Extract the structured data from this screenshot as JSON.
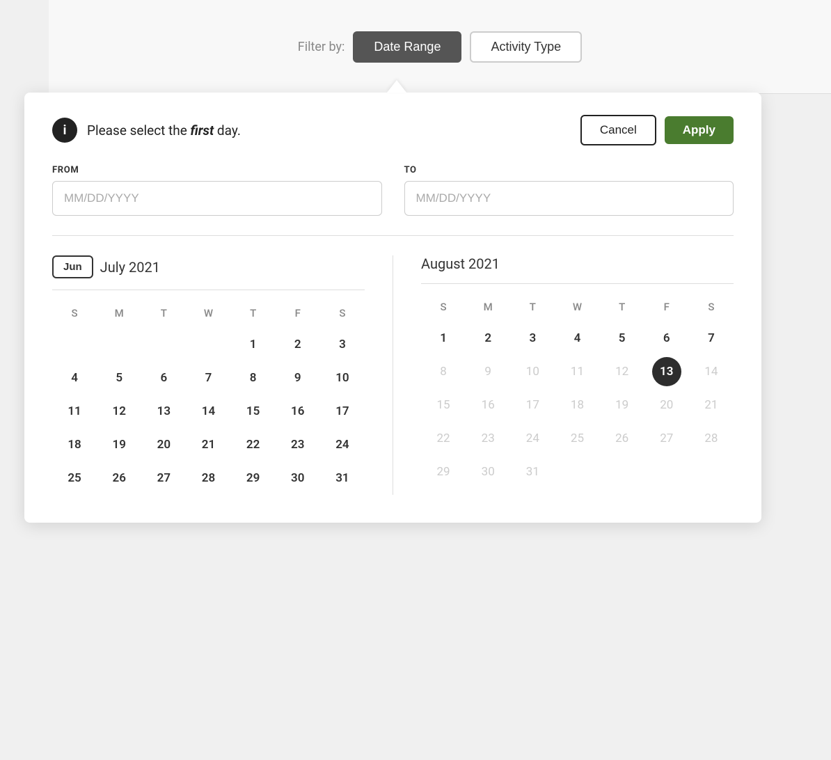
{
  "filterBar": {
    "label": "Filter by:",
    "btnDateRange": "Date Range",
    "btnActivityType": "Activity Type"
  },
  "popup": {
    "infoText1": "Please select the ",
    "infoTextEm": "first",
    "infoText2": " day.",
    "btnCancel": "Cancel",
    "btnApply": "Apply",
    "fromLabel": "FROM",
    "fromPlaceholder": "MM/DD/YYYY",
    "toLabel": "TO",
    "toPlaceholder": "MM/DD/YYYY"
  },
  "calendar1": {
    "navBtn": "Jun",
    "title": "July 2021",
    "headers": [
      "S",
      "M",
      "T",
      "W",
      "T",
      "F",
      "S"
    ],
    "weeks": [
      [
        "",
        "",
        "",
        "",
        "1",
        "2",
        "3"
      ],
      [
        "4",
        "5",
        "6",
        "7",
        "8",
        "9",
        "10"
      ],
      [
        "11",
        "12",
        "13",
        "14",
        "15",
        "16",
        "17"
      ],
      [
        "18",
        "19",
        "20",
        "21",
        "22",
        "23",
        "24"
      ],
      [
        "25",
        "26",
        "27",
        "28",
        "29",
        "30",
        "31"
      ]
    ]
  },
  "calendar2": {
    "title": "August 2021",
    "headers": [
      "S",
      "M",
      "T",
      "W",
      "T",
      "F",
      "S"
    ],
    "weeks": [
      [
        "1",
        "2",
        "3",
        "4",
        "5",
        "6",
        "7"
      ],
      [
        "8",
        "9",
        "10",
        "11",
        "12",
        "13",
        "14"
      ],
      [
        "15",
        "16",
        "17",
        "18",
        "19",
        "20",
        "21"
      ],
      [
        "22",
        "23",
        "24",
        "25",
        "26",
        "27",
        "28"
      ],
      [
        "29",
        "30",
        "31",
        "",
        "",
        "",
        ""
      ]
    ],
    "selectedDay": "13",
    "fadedAfterRow": 1,
    "fadedDays": [
      "15",
      "16",
      "17",
      "18",
      "19",
      "20",
      "21",
      "22",
      "23",
      "24",
      "25",
      "26",
      "27",
      "28",
      "29",
      "30",
      "31"
    ]
  },
  "colors": {
    "activeFilterBg": "#555555",
    "applyBtnBg": "#4a7c2f",
    "selectedDayBg": "#2d2d2d"
  }
}
